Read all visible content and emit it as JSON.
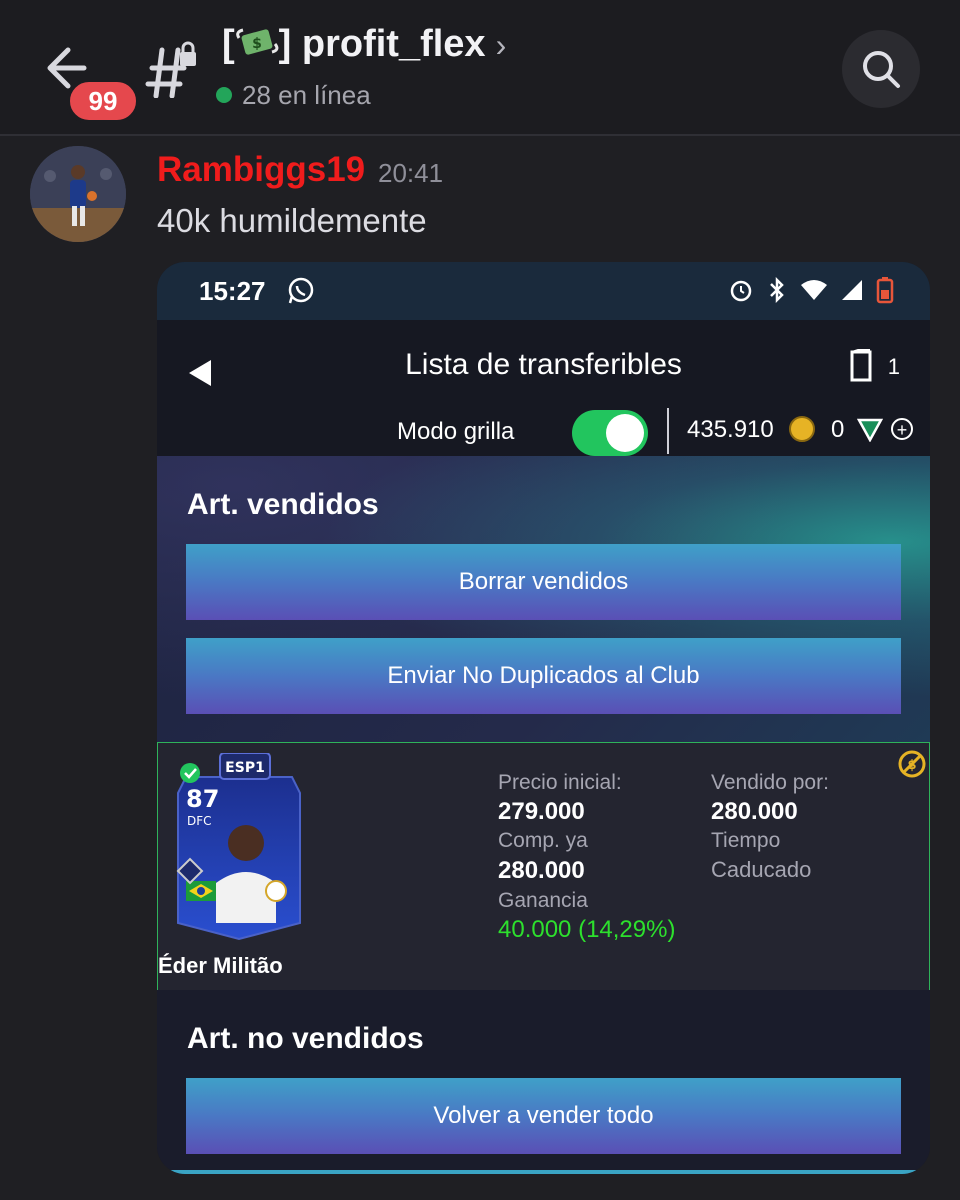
{
  "header": {
    "unread_badge": "99",
    "channel_name": "profit_flex",
    "channel_emoji": "money-with-wings-emoji",
    "online_status": "28 en línea"
  },
  "message": {
    "username": "Rambiggs19",
    "username_color": "#f01c1c",
    "timestamp": "20:41",
    "text": "40k humildemente"
  },
  "screenshot": {
    "status_bar": {
      "time": "15:27"
    },
    "top_bar": {
      "title": "Lista de transferibles",
      "slot_count": "1",
      "grid_mode_label": "Modo grilla",
      "grid_mode_on": true,
      "coins": "435.910",
      "points": "0"
    },
    "sold_section": {
      "title": "Art. vendidos",
      "clear_button": "Borrar vendidos",
      "send_button": "Enviar No Duplicados al Club"
    },
    "item": {
      "player_name": "Éder Militão",
      "rating": "87",
      "position": "DFC",
      "league_tag": "ESP1",
      "start_price_label": "Precio inicial:",
      "start_price": "279.000",
      "buy_now_label": "Comp. ya",
      "buy_now": "280.000",
      "profit_label": "Ganancia",
      "profit": "40.000 (14,29%)",
      "sold_for_label": "Vendido por:",
      "sold_for": "280.000",
      "time_label": "Tiempo",
      "time_value": "Caducado"
    },
    "unsold_section": {
      "title": "Art. no vendidos",
      "relist_button": "Volver a vender todo"
    }
  }
}
